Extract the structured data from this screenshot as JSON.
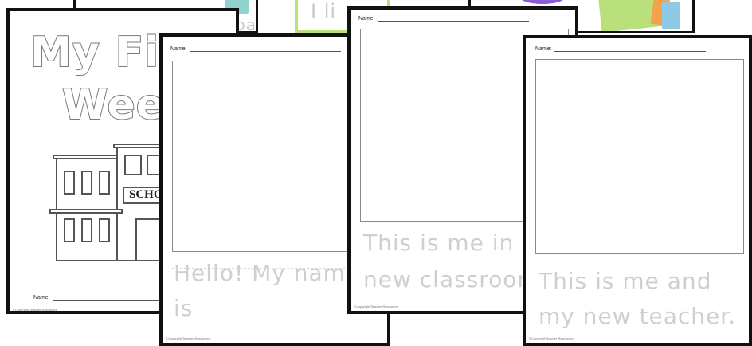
{
  "background_cards": [
    {
      "text": "back"
    },
    {
      "text": "I li"
    },
    {
      "text": ""
    }
  ],
  "cover": {
    "title_line1": "My Fi",
    "title_line2": "Wee",
    "school_sign": "SCHO",
    "name_label": "Name:",
    "footer": "©Copyright Teacher Resources"
  },
  "sheet1": {
    "name_label": "Name:",
    "trace_line1": "Hello! My name",
    "trace_line2": "is",
    "footer": "©Copyright Teacher Resources"
  },
  "sheet2": {
    "name_label": "Name:",
    "trace_line1": "This is me in m",
    "trace_line2": "new classroom",
    "footer": "©Copyright Teacher Resources"
  },
  "sheet3": {
    "name_label": "Name:",
    "trace_line1": "This is me and",
    "trace_line2": "my new teacher.",
    "footer": "©Copyright Teacher Resources"
  },
  "colors": {
    "border": "#111111",
    "trace_text": "#cfcfcf",
    "card_teal": "#8fd3cf",
    "card_green": "#b9e07a",
    "card_purple": "#8a5bd6"
  }
}
